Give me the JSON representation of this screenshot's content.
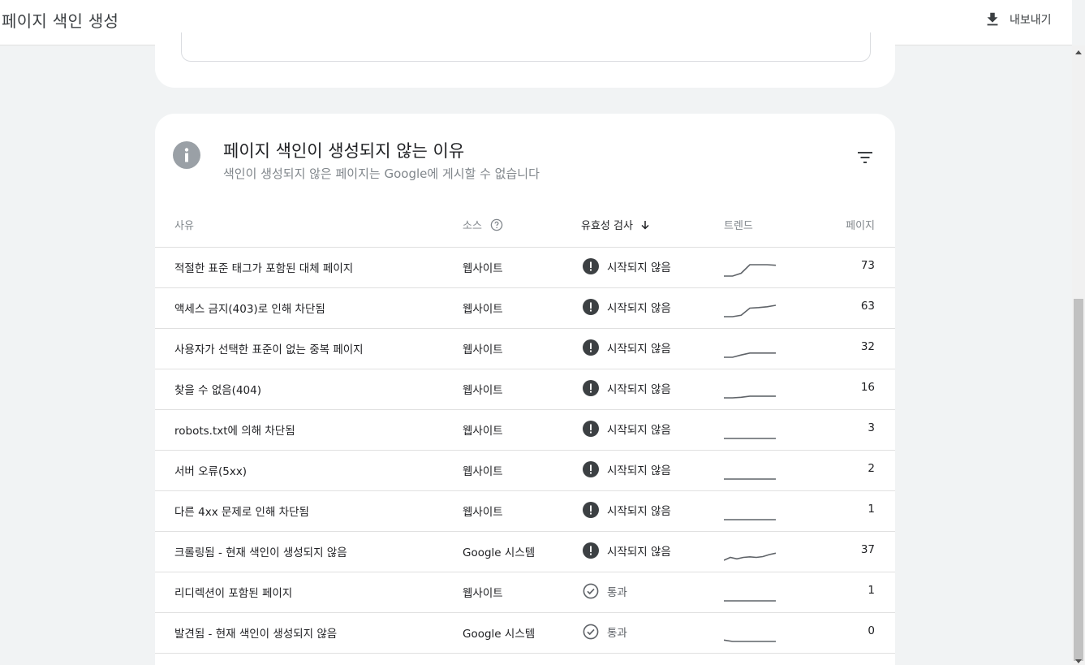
{
  "header": {
    "title": "페이지 색인 생성",
    "export_label": "내보내기"
  },
  "card": {
    "title": "페이지 색인이 생성되지 않는 이유",
    "subtitle": "색인이 생성되지 않은 페이지는 Google에 게시할 수 없습니다"
  },
  "table": {
    "columns": {
      "reason": "사유",
      "source": "소스",
      "validation": "유효성 검사",
      "trend": "트렌드",
      "pages": "페이지"
    },
    "rows": [
      {
        "reason": "적절한 표준 태그가 포함된 대체 페이지",
        "source": "웹사이트",
        "validation": "시작되지 않음",
        "status": "not-started",
        "pages": "73",
        "trend": [
          1,
          1,
          2,
          5,
          5,
          5,
          4.8
        ]
      },
      {
        "reason": "액세스 금지(403)로 인해 차단됨",
        "source": "웹사이트",
        "validation": "시작되지 않음",
        "status": "not-started",
        "pages": "63",
        "trend": [
          1,
          1,
          1.5,
          4,
          4.2,
          4.5,
          5
        ]
      },
      {
        "reason": "사용자가 선택한 표준이 없는 중복 페이지",
        "source": "웹사이트",
        "validation": "시작되지 않음",
        "status": "not-started",
        "pages": "32",
        "trend": [
          1,
          1,
          1.8,
          2.5,
          2.5,
          2.5,
          2.5
        ]
      },
      {
        "reason": "찾을 수 없음(404)",
        "source": "웹사이트",
        "validation": "시작되지 않음",
        "status": "not-started",
        "pages": "16",
        "trend": [
          1,
          1,
          1.2,
          1.6,
          1.6,
          1.6,
          1.6
        ]
      },
      {
        "reason": "robots.txt에 의해 차단됨",
        "source": "웹사이트",
        "validation": "시작되지 않음",
        "status": "not-started",
        "pages": "3",
        "trend": [
          1,
          1,
          1,
          1,
          1,
          1,
          1
        ]
      },
      {
        "reason": "서버 오류(5xx)",
        "source": "웹사이트",
        "validation": "시작되지 않음",
        "status": "not-started",
        "pages": "2",
        "trend": [
          1,
          1,
          1,
          1,
          1,
          1,
          1
        ]
      },
      {
        "reason": "다른 4xx 문제로 인해 차단됨",
        "source": "웹사이트",
        "validation": "시작되지 않음",
        "status": "not-started",
        "pages": "1",
        "trend": [
          1,
          1,
          1,
          1,
          1,
          1,
          1
        ]
      },
      {
        "reason": "크롤링됨 - 현재 색인이 생성되지 않음",
        "source": "Google 시스템",
        "validation": "시작되지 않음",
        "status": "not-started",
        "pages": "37",
        "trend": [
          1,
          2,
          1.5,
          2,
          2.2,
          2,
          2.3,
          3,
          3.5
        ]
      },
      {
        "reason": "리디렉션이 포함된 페이지",
        "source": "웹사이트",
        "validation": "통과",
        "status": "passed",
        "pages": "1",
        "trend": [
          1,
          1,
          1,
          1,
          1,
          1,
          1
        ]
      },
      {
        "reason": "발견됨 - 현재 색인이 생성되지 않음",
        "source": "Google 시스템",
        "validation": "통과",
        "status": "passed",
        "pages": "0",
        "trend": [
          1.5,
          1,
          1,
          1,
          1,
          1,
          1
        ]
      }
    ]
  },
  "colors": {
    "status_icon": "#3c4043",
    "pass_icon": "#5f6368",
    "sparkline": "#5f6368",
    "info_icon_bg": "#9aa0a6"
  }
}
